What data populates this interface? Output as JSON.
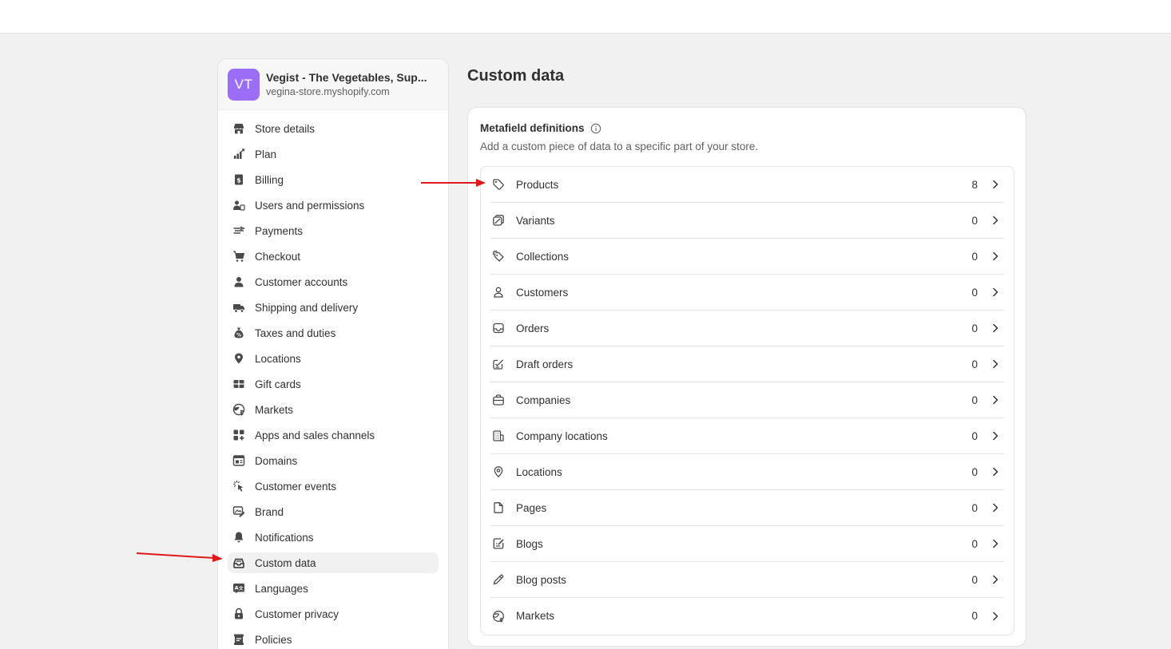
{
  "store": {
    "initials": "VT",
    "name": "Vegist - The Vegetables, Sup...",
    "url": "vegina-store.myshopify.com",
    "avatar_color": "#9c6ef8"
  },
  "sidebar": {
    "items": [
      {
        "label": "Store details",
        "icon": "store-icon"
      },
      {
        "label": "Plan",
        "icon": "plan-icon"
      },
      {
        "label": "Billing",
        "icon": "billing-icon"
      },
      {
        "label": "Users and permissions",
        "icon": "users-icon"
      },
      {
        "label": "Payments",
        "icon": "payments-icon"
      },
      {
        "label": "Checkout",
        "icon": "cart-icon"
      },
      {
        "label": "Customer accounts",
        "icon": "person-icon"
      },
      {
        "label": "Shipping and delivery",
        "icon": "truck-icon"
      },
      {
        "label": "Taxes and duties",
        "icon": "taxes-icon"
      },
      {
        "label": "Locations",
        "icon": "location-pin-icon"
      },
      {
        "label": "Gift cards",
        "icon": "gift-card-icon"
      },
      {
        "label": "Markets",
        "icon": "globe-icon"
      },
      {
        "label": "Apps and sales channels",
        "icon": "apps-icon"
      },
      {
        "label": "Domains",
        "icon": "domains-icon"
      },
      {
        "label": "Customer events",
        "icon": "cursor-click-icon"
      },
      {
        "label": "Brand",
        "icon": "brand-icon"
      },
      {
        "label": "Notifications",
        "icon": "bell-icon"
      },
      {
        "label": "Custom data",
        "icon": "custom-data-icon",
        "active": true
      },
      {
        "label": "Languages",
        "icon": "languages-icon"
      },
      {
        "label": "Customer privacy",
        "icon": "lock-icon"
      },
      {
        "label": "Policies",
        "icon": "policies-icon"
      }
    ]
  },
  "main": {
    "title": "Custom data",
    "card": {
      "title": "Metafield definitions",
      "description": "Add a custom piece of data to a specific part of your store.",
      "rows": [
        {
          "label": "Products",
          "count": "8",
          "icon": "tag-icon"
        },
        {
          "label": "Variants",
          "count": "0",
          "icon": "variants-icon"
        },
        {
          "label": "Collections",
          "count": "0",
          "icon": "collections-icon"
        },
        {
          "label": "Customers",
          "count": "0",
          "icon": "person-icon"
        },
        {
          "label": "Orders",
          "count": "0",
          "icon": "inbox-icon"
        },
        {
          "label": "Draft orders",
          "count": "0",
          "icon": "draft-order-icon"
        },
        {
          "label": "Companies",
          "count": "0",
          "icon": "briefcase-icon"
        },
        {
          "label": "Company locations",
          "count": "0",
          "icon": "building-icon"
        },
        {
          "label": "Locations",
          "count": "0",
          "icon": "location-pin-icon"
        },
        {
          "label": "Pages",
          "count": "0",
          "icon": "page-icon"
        },
        {
          "label": "Blogs",
          "count": "0",
          "icon": "blog-icon"
        },
        {
          "label": "Blog posts",
          "count": "0",
          "icon": "pencil-icon"
        },
        {
          "label": "Markets",
          "count": "0",
          "icon": "globe-icon"
        }
      ]
    }
  },
  "colors": {
    "background": "#f1f1f1",
    "annotation_arrow": "#e0191b"
  }
}
